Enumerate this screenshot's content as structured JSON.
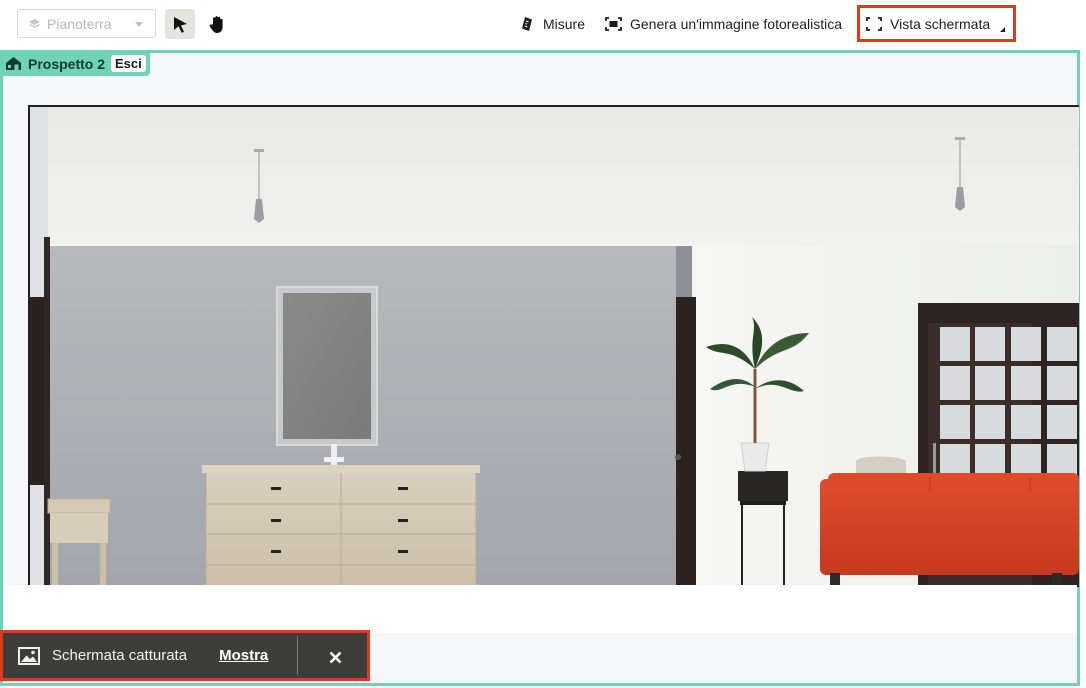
{
  "toolbar": {
    "floor_select": {
      "value": "Pianoterra"
    },
    "measure_label": "Misure",
    "photo_label": "Genera un'immagine fotorealistica",
    "screen_view_label": "Vista schermata"
  },
  "elevation": {
    "name": "Prospetto 2",
    "exit_label": "Esci"
  },
  "toast": {
    "message": "Schermata catturata",
    "link_label": "Mostra"
  },
  "icons": {
    "layers": "layers-icon",
    "pointer": "pointer-arrow-icon",
    "hand": "hand-pan-icon",
    "ruler": "ruler-icon",
    "camera": "photo-frame-icon",
    "screen": "screen-corners-icon",
    "house": "house-icon",
    "image": "image-icon",
    "close": "close-icon"
  },
  "colors": {
    "accent": "#6fd3b7",
    "highlight": "#e03a1e",
    "toast_bg": "#3d3d3b"
  }
}
